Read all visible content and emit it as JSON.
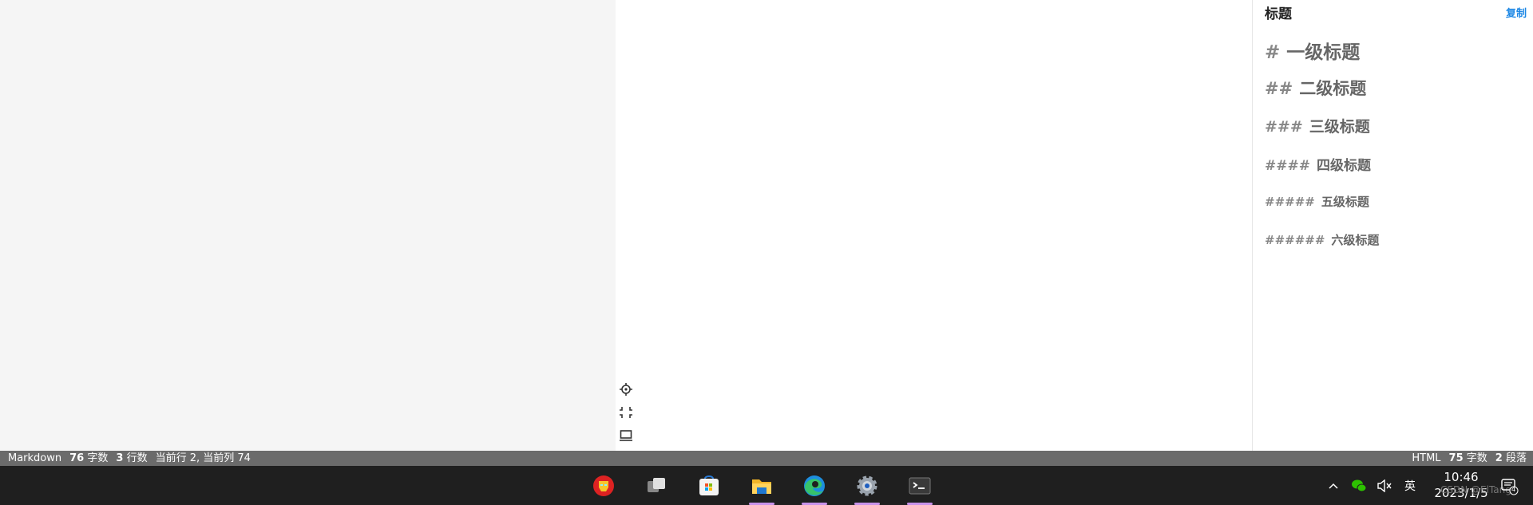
{
  "reference_panel": {
    "title": "标题",
    "copy_label": "复制",
    "items": [
      {
        "hash": "#",
        "text": "一级标题"
      },
      {
        "hash": "##",
        "text": "二级标题"
      },
      {
        "hash": "###",
        "text": "三级标题"
      },
      {
        "hash": "####",
        "text": "四级标题"
      },
      {
        "hash": "#####",
        "text": "五级标题"
      },
      {
        "hash": "######",
        "text": "六级标题"
      }
    ]
  },
  "side_tools": [
    "locate-icon",
    "fullscreen-icon",
    "preview-icon"
  ],
  "statusbar": {
    "left": {
      "mode": "Markdown",
      "chars_num": "76",
      "chars_label": "字数",
      "lines_num": "3",
      "lines_label": "行数",
      "cursor_label": "当前行 2, 当前列 74"
    },
    "right": {
      "mode": "HTML",
      "chars_num": "75",
      "chars_label": "字数",
      "paras_num": "2",
      "paras_label": "段落"
    }
  },
  "taskbar": {
    "apps": [
      {
        "icon": "ironman-app-icon",
        "active": false
      },
      {
        "icon": "task-view-icon",
        "active": false
      },
      {
        "icon": "microsoft-store-icon",
        "active": false
      },
      {
        "icon": "file-explorer-icon",
        "active": true
      },
      {
        "icon": "edge-browser-icon",
        "active": true
      },
      {
        "icon": "settings-gear-icon",
        "active": true
      },
      {
        "icon": "terminal-icon",
        "active": true
      }
    ],
    "tray": {
      "ime": "英"
    },
    "clock": {
      "time": "10:46",
      "date": "2023/1/5"
    },
    "watermark": "CSDN @ElTang",
    "notification_count": "4"
  },
  "colors": {
    "accent": "#1e88e5",
    "statusbar": "#6b6b6b",
    "taskbar": "#1f1f1f",
    "indicator": "#c792ea"
  }
}
